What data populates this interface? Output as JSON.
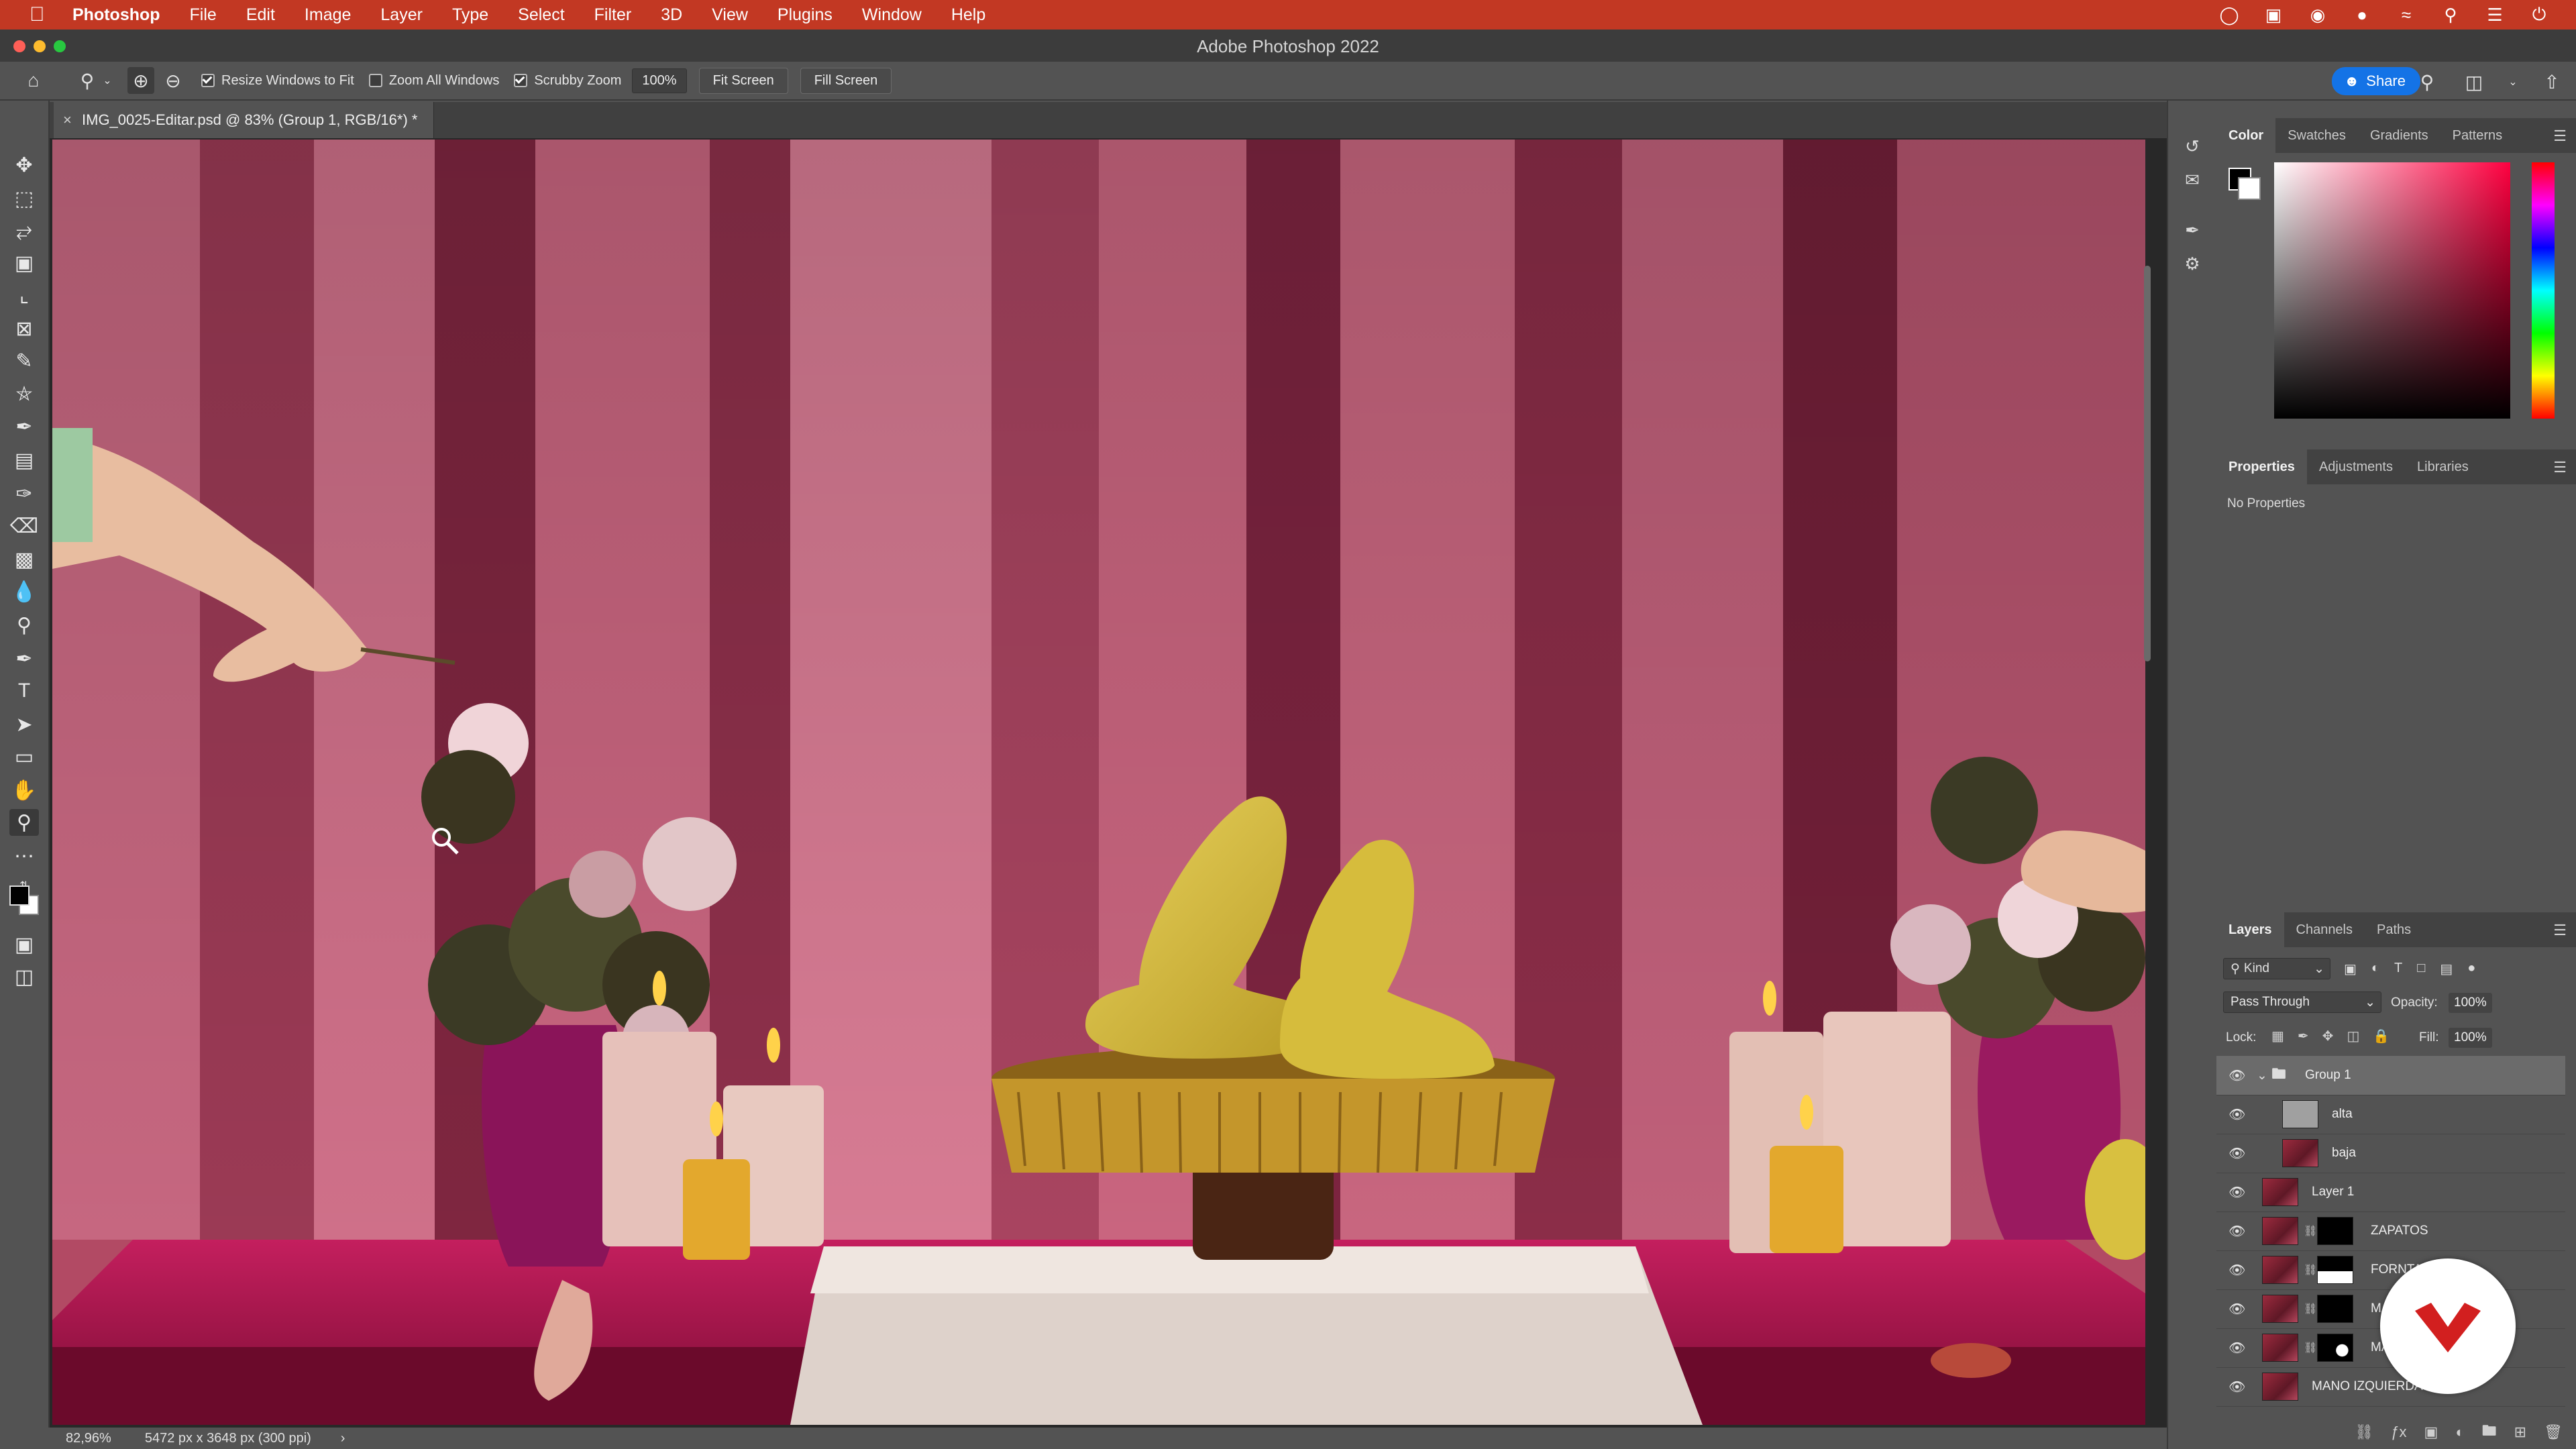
{
  "menubar": {
    "app": "Photoshop",
    "items": [
      "File",
      "Edit",
      "Image",
      "Layer",
      "Type",
      "Select",
      "Filter",
      "3D",
      "View",
      "Plugins",
      "Window",
      "Help"
    ],
    "status_icons": [
      "creative-cloud-icon",
      "display-icon",
      "vpn-icon",
      "record-icon",
      "wifi-icon",
      "search-icon",
      "control-center-icon",
      "power-icon"
    ]
  },
  "window": {
    "title": "Adobe Photoshop 2022"
  },
  "options": {
    "resize_windows": "Resize Windows to Fit",
    "zoom_all": "Zoom All Windows",
    "scrubby_zoom": "Scrubby Zoom",
    "zoom_value": "100%",
    "fit_screen": "Fit Screen",
    "fill_screen": "Fill Screen",
    "share": "Share"
  },
  "document": {
    "tab": "IMG_0025-Editar.psd @ 83% (Group 1, RGB/16*) *"
  },
  "status": {
    "zoom": "82,96%",
    "dims": "5472 px x 3648 px (300 ppi)",
    "caret": "›"
  },
  "color_panel": {
    "tabs": [
      "Color",
      "Swatches",
      "Gradients",
      "Patterns"
    ]
  },
  "properties_panel": {
    "tabs": [
      "Properties",
      "Adjustments",
      "Libraries"
    ],
    "empty": "No Properties"
  },
  "layers_panel": {
    "tabs": [
      "Layers",
      "Channels",
      "Paths"
    ],
    "kind": "Kind",
    "blend_mode": "Pass Through",
    "opacity_label": "Opacity:",
    "opacity": "100%",
    "lock_label": "Lock:",
    "fill_label": "Fill:",
    "fill": "100%",
    "layers": [
      {
        "name": "Group 1"
      },
      {
        "name": "alta"
      },
      {
        "name": "baja"
      },
      {
        "name": "Layer 1"
      },
      {
        "name": "ZAPATOS"
      },
      {
        "name": "FORNTAL"
      },
      {
        "name": "MA"
      },
      {
        "name": "MA"
      },
      {
        "name": "MANO IZQUIERDA"
      }
    ]
  }
}
